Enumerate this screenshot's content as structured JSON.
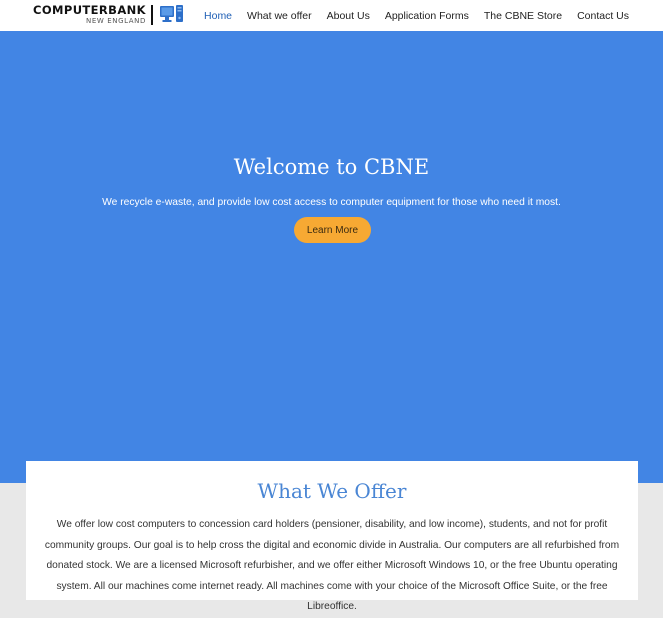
{
  "header": {
    "logo": {
      "main": "COMPUTERBANK",
      "sub": "NEW ENGLAND",
      "icon": "computer-monitor-icon"
    },
    "nav": [
      {
        "label": "Home",
        "active": true
      },
      {
        "label": "What we offer",
        "active": false
      },
      {
        "label": "About Us",
        "active": false
      },
      {
        "label": "Application Forms",
        "active": false
      },
      {
        "label": "The CBNE Store",
        "active": false
      },
      {
        "label": "Contact Us",
        "active": false
      }
    ]
  },
  "hero": {
    "title": "Welcome to CBNE",
    "subtitle": "We recycle e-waste, and provide low cost access to computer equipment for those who need it most.",
    "button_label": "Learn More"
  },
  "offer": {
    "title": "What We Offer",
    "text": "We offer low cost computers to concession card holders (pensioner, disability, and low income), students, and not for profit community groups. Our goal is to help cross the digital and economic divide in Australia. Our computers are all refurbished from donated stock. We are a licensed Microsoft refurbisher, and we offer either Microsoft Windows 10, or the free Ubuntu operating system. All our machines come internet ready. All machines come with your choice of the Microsoft Office Suite, or the free Libreoffice."
  },
  "colors": {
    "hero_bg": "#4285e4",
    "button": "#f7a933",
    "offer_title": "#4a86d4",
    "page_bg": "#e8e8e8"
  }
}
